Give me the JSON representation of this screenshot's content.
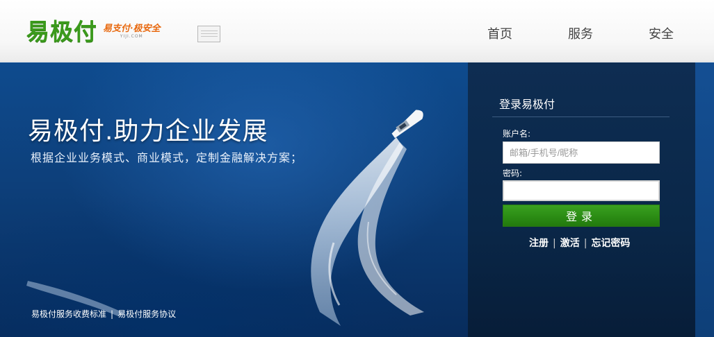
{
  "header": {
    "logo_text": "易极付",
    "logo_slogan": "易支付·极安全",
    "logo_domain": "YIJI.COM",
    "nav": [
      {
        "label": "首页"
      },
      {
        "label": "服务"
      },
      {
        "label": "安全"
      }
    ]
  },
  "banner": {
    "title": "易极付.助力企业发展",
    "subtitle": "根据企业业务模式、商业模式，定制金融解决方案；",
    "footer_links": [
      {
        "label": "易极付服务收费标准"
      },
      {
        "label": "易极付服务协议"
      }
    ],
    "footer_separator": "|"
  },
  "login": {
    "title": "登录易极付",
    "account_label": "账户名:",
    "account_placeholder": "邮箱/手机号/昵称",
    "account_value": "",
    "password_label": "密码:",
    "password_value": "",
    "submit_label": "登录",
    "links": [
      {
        "label": "注册"
      },
      {
        "label": "激活"
      },
      {
        "label": "忘记密码"
      }
    ],
    "link_separator": "|"
  },
  "colors": {
    "brand_green": "#3b9a1c",
    "slogan_orange": "#e8690f",
    "banner_blue": "#0d3f7a",
    "panel_navy": "#0a2748",
    "button_green": "#2b8c14"
  }
}
